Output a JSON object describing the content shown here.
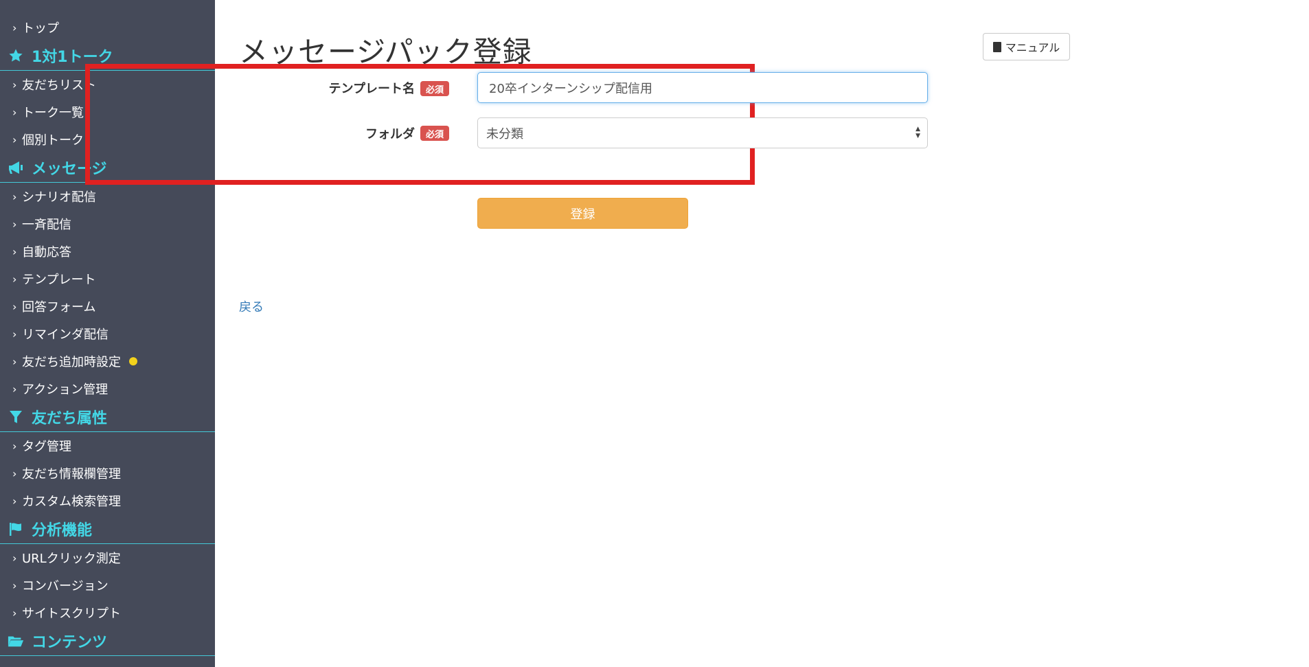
{
  "sidebar": {
    "items": [
      {
        "type": "item",
        "label": "トップ"
      },
      {
        "type": "section",
        "label": "1対1トーク",
        "icon": "star-icon"
      },
      {
        "type": "item",
        "label": "友だちリスト"
      },
      {
        "type": "item",
        "label": "トーク一覧"
      },
      {
        "type": "item",
        "label": "個別トーク"
      },
      {
        "type": "section",
        "label": "メッセージ",
        "icon": "megaphone-icon"
      },
      {
        "type": "item",
        "label": "シナリオ配信"
      },
      {
        "type": "item",
        "label": "一斉配信"
      },
      {
        "type": "item",
        "label": "自動応答"
      },
      {
        "type": "item",
        "label": "テンプレート"
      },
      {
        "type": "item",
        "label": "回答フォーム"
      },
      {
        "type": "item",
        "label": "リマインダ配信"
      },
      {
        "type": "item",
        "label": "友だち追加時設定",
        "dot_color": "#f2d21c"
      },
      {
        "type": "item",
        "label": "アクション管理"
      },
      {
        "type": "section",
        "label": "友だち属性",
        "icon": "filter-icon"
      },
      {
        "type": "item",
        "label": "タグ管理"
      },
      {
        "type": "item",
        "label": "友だち情報欄管理"
      },
      {
        "type": "item",
        "label": "カスタム検索管理"
      },
      {
        "type": "section",
        "label": "分析機能",
        "icon": "flag-icon"
      },
      {
        "type": "item",
        "label": "URLクリック測定"
      },
      {
        "type": "item",
        "label": "コンバージョン"
      },
      {
        "type": "item",
        "label": "サイトスクリプト"
      },
      {
        "type": "section",
        "label": "コンテンツ",
        "icon": "folder-open-icon"
      }
    ]
  },
  "header": {
    "title": "メッセージパック登録",
    "manual_label": "マニュアル"
  },
  "form": {
    "template_name_label": "テンプレート名",
    "folder_label": "フォルダ",
    "required_badge": "必須",
    "template_name_value": "20卒インターンシップ配信用",
    "folder_value": "未分類",
    "submit_label": "登録"
  },
  "footer": {
    "back_label": "戻る"
  },
  "colors": {
    "sidebar_bg": "#454a59",
    "section_accent": "#43d7e6",
    "highlight": "#e02121",
    "submit": "#f0ad4e",
    "badge": "#d9534f",
    "link": "#337ab7"
  }
}
